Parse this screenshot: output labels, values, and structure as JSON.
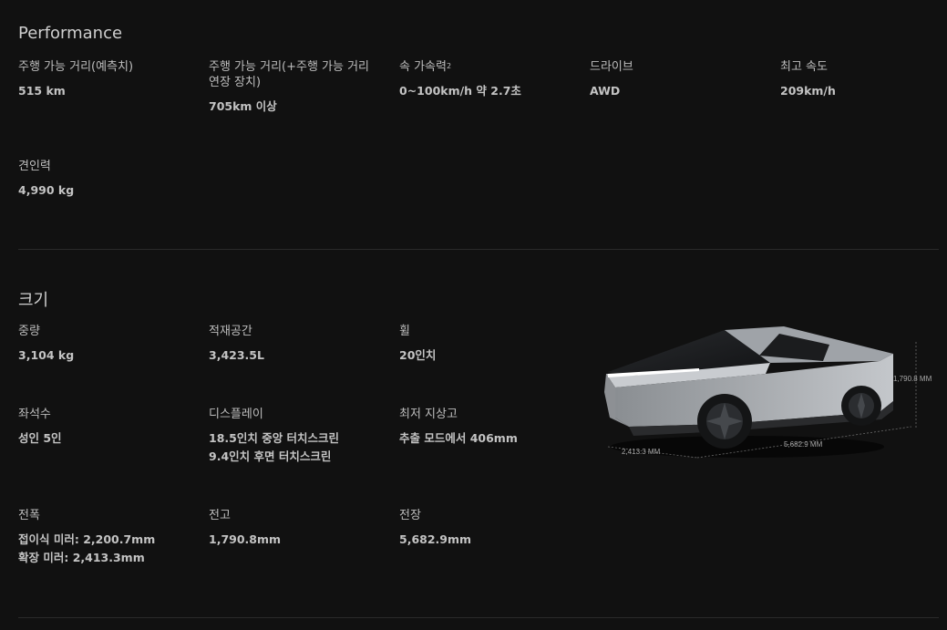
{
  "performance": {
    "title": "Performance",
    "specs": [
      {
        "label": "주행 가능 거리(예측치)",
        "value": [
          "515 km"
        ]
      },
      {
        "label": "주행 가능 거리(+주행 가능 거리 연장 장치)",
        "value": [
          "705km 이상"
        ]
      },
      {
        "label": "속 가속력",
        "sup": "2",
        "value": [
          "0~100km/h 약 2.7초"
        ]
      },
      {
        "label": "드라이브",
        "value": [
          "AWD"
        ]
      },
      {
        "label": "최고 속도",
        "value": [
          "209km/h"
        ]
      },
      {
        "label": "견인력",
        "value": [
          "4,990 kg"
        ]
      }
    ]
  },
  "dimensions": {
    "title": "크기",
    "specs": [
      {
        "label": "중량",
        "value": [
          "3,104 kg"
        ]
      },
      {
        "label": "적재공간",
        "value": [
          "3,423.5L"
        ]
      },
      {
        "label": "휠",
        "value": [
          "20인치"
        ]
      },
      {
        "label": "좌석수",
        "value": [
          "성인 5인"
        ]
      },
      {
        "label": "디스플레이",
        "value": [
          "18.5인치 중앙 터치스크린",
          "9.4인치 후면 터치스크린"
        ]
      },
      {
        "label": "최저 지상고",
        "value": [
          "추출 모드에서 406mm"
        ]
      },
      {
        "label": "전폭",
        "value": [
          "접이식 미러: 2,200.7mm",
          "확장 미러: 2,413.3mm"
        ]
      },
      {
        "label": "전고",
        "value": [
          "1,790.8mm"
        ]
      },
      {
        "label": "전장",
        "value": [
          "5,682.9mm"
        ]
      }
    ],
    "image": {
      "height_label": "1,790.8 MM",
      "width_label": "2,413.3 MM",
      "length_label": "5,682.9 MM"
    }
  }
}
